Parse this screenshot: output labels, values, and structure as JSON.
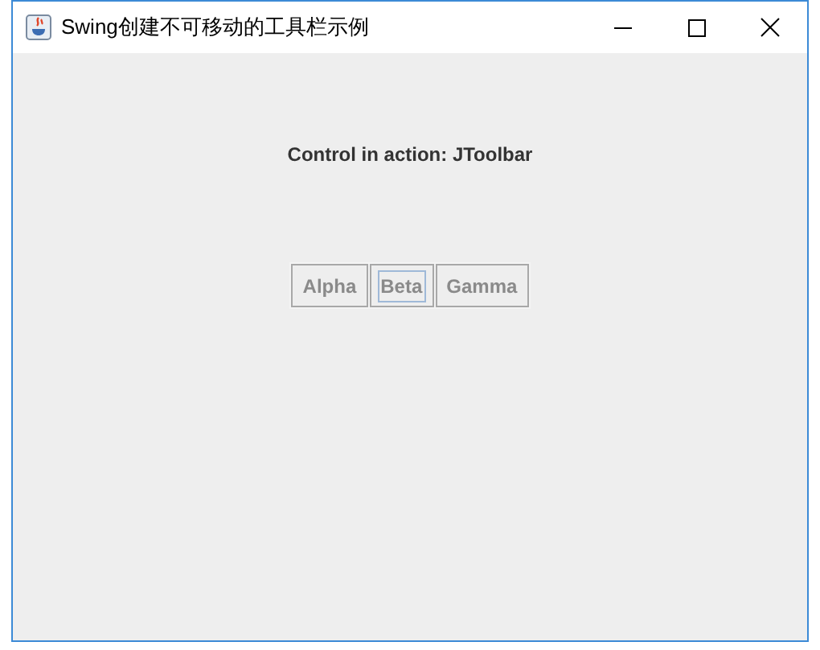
{
  "window": {
    "title": "Swing创建不可移动的工具栏示例"
  },
  "label": "Control in action: JToolbar",
  "toolbar": {
    "buttons": [
      {
        "label": "Alpha",
        "focused": false
      },
      {
        "label": "Beta",
        "focused": true
      },
      {
        "label": "Gamma",
        "focused": false
      }
    ]
  }
}
